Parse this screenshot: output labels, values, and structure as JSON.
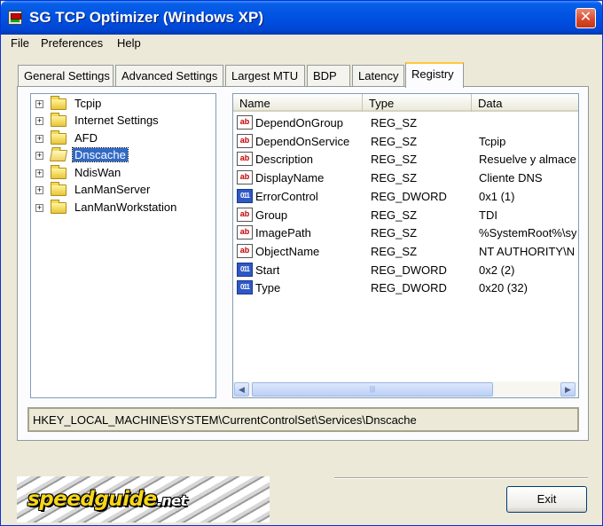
{
  "window": {
    "title": "SG TCP Optimizer (Windows XP)",
    "close_glyph": "✕"
  },
  "menu": [
    {
      "label": "File"
    },
    {
      "label": "Preferences"
    },
    {
      "label": "Help"
    }
  ],
  "tabs": [
    {
      "label": "General Settings"
    },
    {
      "label": "Advanced Settings"
    },
    {
      "label": "Largest MTU"
    },
    {
      "label": "BDP"
    },
    {
      "label": "Latency"
    },
    {
      "label": "Registry",
      "active": true
    }
  ],
  "tree": {
    "items": [
      {
        "label": "Tcpip",
        "expander": "+"
      },
      {
        "label": "Internet Settings",
        "expander": "+"
      },
      {
        "label": "AFD",
        "expander": "+"
      },
      {
        "label": "Dnscache",
        "expander": "+",
        "selected": true
      },
      {
        "label": "NdisWan",
        "expander": "+"
      },
      {
        "label": "LanManServer",
        "expander": "+"
      },
      {
        "label": "LanManWorkstation",
        "expander": "+"
      }
    ]
  },
  "list": {
    "columns": [
      "Name",
      "Type",
      "Data"
    ],
    "rows": [
      {
        "name": "DependOnGroup",
        "type": "REG_SZ",
        "data": "",
        "icon": "string-value-icon",
        "glyph": "ab"
      },
      {
        "name": "DependOnService",
        "type": "REG_SZ",
        "data": "Tcpip",
        "icon": "string-value-icon",
        "glyph": "ab"
      },
      {
        "name": "Description",
        "type": "REG_SZ",
        "data": "Resuelve y almace",
        "icon": "string-value-icon",
        "glyph": "ab"
      },
      {
        "name": "DisplayName",
        "type": "REG_SZ",
        "data": "Cliente DNS",
        "icon": "string-value-icon",
        "glyph": "ab"
      },
      {
        "name": "ErrorControl",
        "type": "REG_DWORD",
        "data": "0x1 (1)",
        "icon": "dword-value-icon",
        "glyph": "011"
      },
      {
        "name": "Group",
        "type": "REG_SZ",
        "data": "TDI",
        "icon": "string-value-icon",
        "glyph": "ab"
      },
      {
        "name": "ImagePath",
        "type": "REG_SZ",
        "data": "%SystemRoot%\\sys",
        "icon": "string-value-icon",
        "glyph": "ab"
      },
      {
        "name": "ObjectName",
        "type": "REG_SZ",
        "data": "NT AUTHORITY\\N",
        "icon": "string-value-icon",
        "glyph": "ab"
      },
      {
        "name": "Start",
        "type": "REG_DWORD",
        "data": "0x2 (2)",
        "icon": "dword-value-icon",
        "glyph": "011"
      },
      {
        "name": "Type",
        "type": "REG_DWORD",
        "data": "0x20 (32)",
        "icon": "dword-value-icon",
        "glyph": "011"
      }
    ],
    "scroll": {
      "left_arrow": "◀",
      "right_arrow": "▶",
      "thumb_grip": "|||"
    }
  },
  "path": "HKEY_LOCAL_MACHINE\\SYSTEM\\CurrentControlSet\\Services\\Dnscache",
  "logo": {
    "text": "speedguide",
    "suffix": ".net"
  },
  "buttons": {
    "exit": "Exit"
  },
  "colors": {
    "titlebar": "#0054e3",
    "window_bg": "#ece9d8",
    "selection": "#316ac5",
    "tab_highlight": "#ffc83c",
    "logo_yellow": "#f7d617"
  }
}
